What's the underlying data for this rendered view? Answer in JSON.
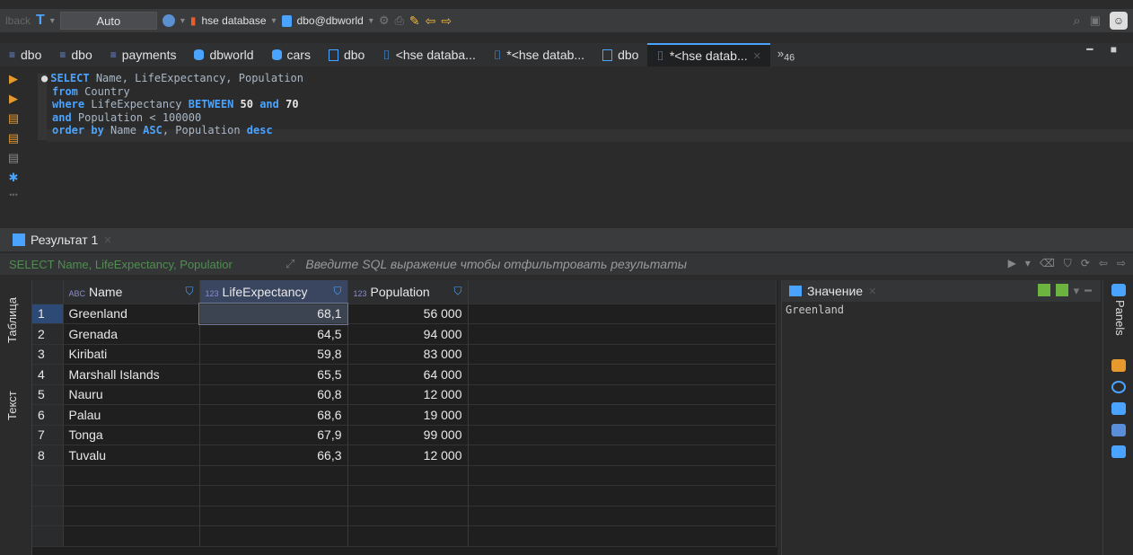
{
  "toolbar": {
    "faded_label": "lback",
    "mode": "Auto",
    "connection": "hse database",
    "schema": "dbo@dbworld"
  },
  "tabs": [
    {
      "label": "dbo",
      "icon": "sql-editor-icon"
    },
    {
      "label": "dbo",
      "icon": "sql-editor-icon"
    },
    {
      "label": "payments",
      "icon": "sql-editor-icon"
    },
    {
      "label": "dbworld",
      "icon": "database-icon"
    },
    {
      "label": "cars",
      "icon": "database-icon"
    },
    {
      "label": "dbo",
      "icon": "schema-icon"
    },
    {
      "label": "<hse databa...",
      "icon": "script-icon"
    },
    {
      "label": "*<hse datab...",
      "icon": "script-icon"
    },
    {
      "label": "dbo",
      "icon": "schema-icon"
    },
    {
      "label": "*<hse datab...",
      "icon": "script-icon",
      "active": true
    }
  ],
  "overflow_count": "46",
  "editor": {
    "lines": [
      [
        "SELECT",
        " Name, LifeExpectancy, Population"
      ],
      [
        "from",
        " Country"
      ],
      [
        "where",
        " LifeExpectancy ",
        "BETWEEN",
        " 50 ",
        "and",
        " 70"
      ],
      [
        "and",
        " Population < 100000"
      ],
      [
        "order by",
        " Name ",
        "ASC",
        ", Population ",
        "desc"
      ]
    ]
  },
  "results": {
    "tab_label": "Результат 1",
    "filter_sql": "SELECT Name, LifeExpectancy, Populatior",
    "filter_placeholder": "Введите SQL выражение чтобы отфильтровать результаты",
    "side_tab_table": "Таблица",
    "side_tab_text": "Текст",
    "columns": [
      "Name",
      "LifeExpectancy",
      "Population"
    ],
    "column_types": [
      "ABC",
      "123",
      "123"
    ],
    "rows": [
      {
        "n": "1",
        "name": "Greenland",
        "life": "68,1",
        "pop": "56 000"
      },
      {
        "n": "2",
        "name": "Grenada",
        "life": "64,5",
        "pop": "94 000"
      },
      {
        "n": "3",
        "name": "Kiribati",
        "life": "59,8",
        "pop": "83 000"
      },
      {
        "n": "4",
        "name": "Marshall Islands",
        "life": "65,5",
        "pop": "64 000"
      },
      {
        "n": "5",
        "name": "Nauru",
        "life": "60,8",
        "pop": "12 000"
      },
      {
        "n": "6",
        "name": "Palau",
        "life": "68,6",
        "pop": "19 000"
      },
      {
        "n": "7",
        "name": "Tonga",
        "life": "67,9",
        "pop": "99 000"
      },
      {
        "n": "8",
        "name": "Tuvalu",
        "life": "66,3",
        "pop": "12 000"
      }
    ]
  },
  "value_panel": {
    "title": "Значение",
    "value": "Greenland"
  },
  "panels_label": "Panels",
  "colors": {
    "accent": "#4aa3ff",
    "background": "#2b2b2b",
    "filter_sql": "#4f8f4f"
  }
}
